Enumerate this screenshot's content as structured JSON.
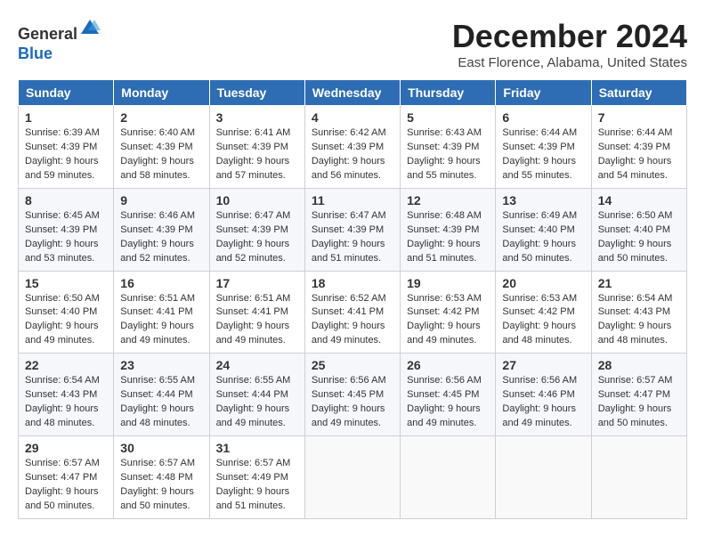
{
  "header": {
    "logo_line1": "General",
    "logo_line2": "Blue",
    "month": "December 2024",
    "location": "East Florence, Alabama, United States"
  },
  "weekdays": [
    "Sunday",
    "Monday",
    "Tuesday",
    "Wednesday",
    "Thursday",
    "Friday",
    "Saturday"
  ],
  "weeks": [
    [
      {
        "day": 1,
        "sunrise": "6:39 AM",
        "sunset": "4:39 PM",
        "daylight": "9 hours and 59 minutes."
      },
      {
        "day": 2,
        "sunrise": "6:40 AM",
        "sunset": "4:39 PM",
        "daylight": "9 hours and 58 minutes."
      },
      {
        "day": 3,
        "sunrise": "6:41 AM",
        "sunset": "4:39 PM",
        "daylight": "9 hours and 57 minutes."
      },
      {
        "day": 4,
        "sunrise": "6:42 AM",
        "sunset": "4:39 PM",
        "daylight": "9 hours and 56 minutes."
      },
      {
        "day": 5,
        "sunrise": "6:43 AM",
        "sunset": "4:39 PM",
        "daylight": "9 hours and 55 minutes."
      },
      {
        "day": 6,
        "sunrise": "6:44 AM",
        "sunset": "4:39 PM",
        "daylight": "9 hours and 55 minutes."
      },
      {
        "day": 7,
        "sunrise": "6:44 AM",
        "sunset": "4:39 PM",
        "daylight": "9 hours and 54 minutes."
      }
    ],
    [
      {
        "day": 8,
        "sunrise": "6:45 AM",
        "sunset": "4:39 PM",
        "daylight": "9 hours and 53 minutes."
      },
      {
        "day": 9,
        "sunrise": "6:46 AM",
        "sunset": "4:39 PM",
        "daylight": "9 hours and 52 minutes."
      },
      {
        "day": 10,
        "sunrise": "6:47 AM",
        "sunset": "4:39 PM",
        "daylight": "9 hours and 52 minutes."
      },
      {
        "day": 11,
        "sunrise": "6:47 AM",
        "sunset": "4:39 PM",
        "daylight": "9 hours and 51 minutes."
      },
      {
        "day": 12,
        "sunrise": "6:48 AM",
        "sunset": "4:39 PM",
        "daylight": "9 hours and 51 minutes."
      },
      {
        "day": 13,
        "sunrise": "6:49 AM",
        "sunset": "4:40 PM",
        "daylight": "9 hours and 50 minutes."
      },
      {
        "day": 14,
        "sunrise": "6:50 AM",
        "sunset": "4:40 PM",
        "daylight": "9 hours and 50 minutes."
      }
    ],
    [
      {
        "day": 15,
        "sunrise": "6:50 AM",
        "sunset": "4:40 PM",
        "daylight": "9 hours and 49 minutes."
      },
      {
        "day": 16,
        "sunrise": "6:51 AM",
        "sunset": "4:41 PM",
        "daylight": "9 hours and 49 minutes."
      },
      {
        "day": 17,
        "sunrise": "6:51 AM",
        "sunset": "4:41 PM",
        "daylight": "9 hours and 49 minutes."
      },
      {
        "day": 18,
        "sunrise": "6:52 AM",
        "sunset": "4:41 PM",
        "daylight": "9 hours and 49 minutes."
      },
      {
        "day": 19,
        "sunrise": "6:53 AM",
        "sunset": "4:42 PM",
        "daylight": "9 hours and 49 minutes."
      },
      {
        "day": 20,
        "sunrise": "6:53 AM",
        "sunset": "4:42 PM",
        "daylight": "9 hours and 48 minutes."
      },
      {
        "day": 21,
        "sunrise": "6:54 AM",
        "sunset": "4:43 PM",
        "daylight": "9 hours and 48 minutes."
      }
    ],
    [
      {
        "day": 22,
        "sunrise": "6:54 AM",
        "sunset": "4:43 PM",
        "daylight": "9 hours and 48 minutes."
      },
      {
        "day": 23,
        "sunrise": "6:55 AM",
        "sunset": "4:44 PM",
        "daylight": "9 hours and 48 minutes."
      },
      {
        "day": 24,
        "sunrise": "6:55 AM",
        "sunset": "4:44 PM",
        "daylight": "9 hours and 49 minutes."
      },
      {
        "day": 25,
        "sunrise": "6:56 AM",
        "sunset": "4:45 PM",
        "daylight": "9 hours and 49 minutes."
      },
      {
        "day": 26,
        "sunrise": "6:56 AM",
        "sunset": "4:45 PM",
        "daylight": "9 hours and 49 minutes."
      },
      {
        "day": 27,
        "sunrise": "6:56 AM",
        "sunset": "4:46 PM",
        "daylight": "9 hours and 49 minutes."
      },
      {
        "day": 28,
        "sunrise": "6:57 AM",
        "sunset": "4:47 PM",
        "daylight": "9 hours and 50 minutes."
      }
    ],
    [
      {
        "day": 29,
        "sunrise": "6:57 AM",
        "sunset": "4:47 PM",
        "daylight": "9 hours and 50 minutes."
      },
      {
        "day": 30,
        "sunrise": "6:57 AM",
        "sunset": "4:48 PM",
        "daylight": "9 hours and 50 minutes."
      },
      {
        "day": 31,
        "sunrise": "6:57 AM",
        "sunset": "4:49 PM",
        "daylight": "9 hours and 51 minutes."
      },
      null,
      null,
      null,
      null
    ]
  ],
  "labels": {
    "sunrise": "Sunrise:",
    "sunset": "Sunset:",
    "daylight": "Daylight:"
  }
}
